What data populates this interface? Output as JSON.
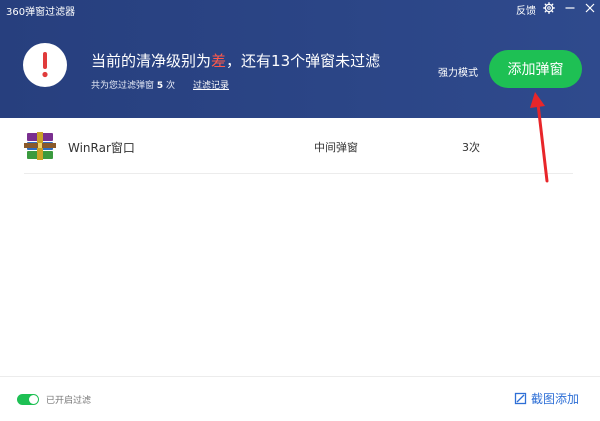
{
  "window": {
    "title": "360弹窗过滤器",
    "feedback_label": "反馈"
  },
  "status": {
    "headline_prefix": "当前的清净级别为",
    "level": "差",
    "headline_suffix": "，还有13个弹窗未过滤",
    "filtered_prefix": "共为您过滤弹窗",
    "filtered_count": "5",
    "filtered_unit": "次",
    "history_link": "过滤记录"
  },
  "actions": {
    "strong_mode_label": "强力模式",
    "add_popup_label": "添加弹窗"
  },
  "list": [
    {
      "name": "WinRar窗口",
      "type": "中间弹窗",
      "count": "3次",
      "icon": "winrar-icon"
    }
  ],
  "footer": {
    "filter_enabled": true,
    "filter_label": "已开启过滤",
    "screenshot_add_label": "截图添加"
  },
  "colors": {
    "header_bg": "#2b4586",
    "accent_green": "#1ec054",
    "warning_red": "#e03b3b",
    "arrow_red": "#e8262a",
    "link_blue": "#2e6fd6"
  }
}
